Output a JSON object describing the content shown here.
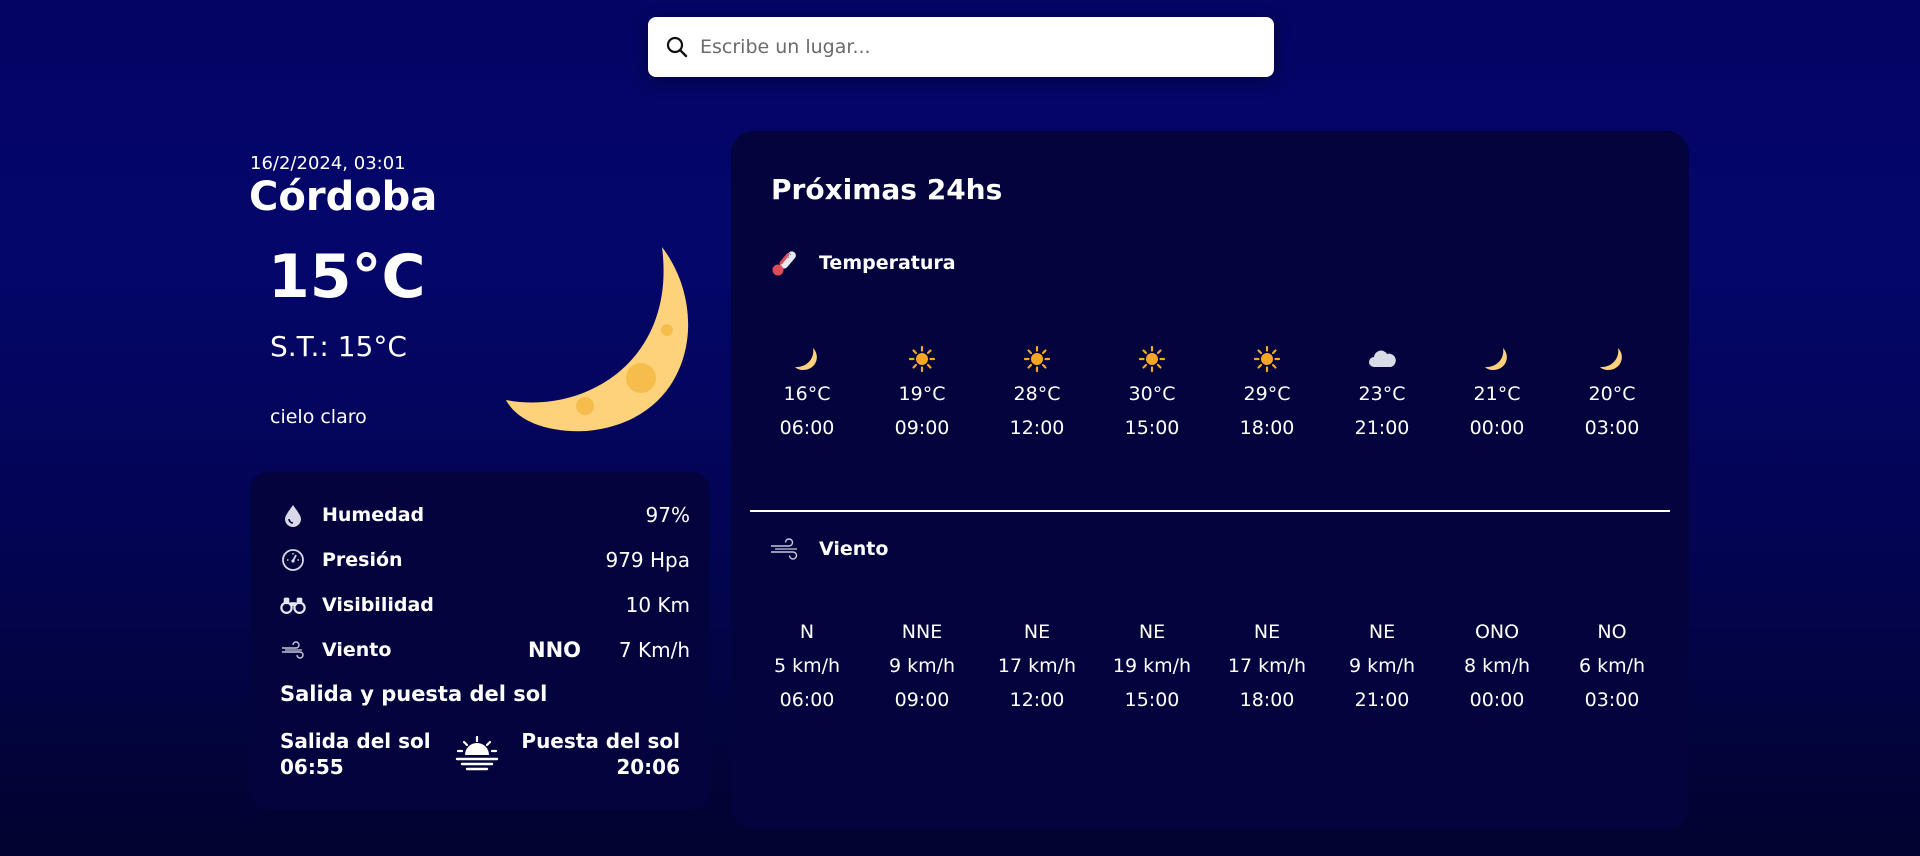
{
  "search": {
    "placeholder": "Escribe un lugar...",
    "icon": "search-icon"
  },
  "current": {
    "datetime": "16/2/2024, 03:01",
    "city": "Córdoba",
    "temp": "15°C",
    "feels_like": "S.T.: 15°C",
    "description": "cielo claro",
    "icon": "crescent-moon-icon"
  },
  "details": {
    "humidity": {
      "label": "Humedad",
      "value": "97%",
      "icon": "droplet-icon"
    },
    "pressure": {
      "label": "Presión",
      "value": "979 Hpa",
      "icon": "gauge-icon"
    },
    "visibility": {
      "label": "Visibilidad",
      "value": "10 Km",
      "icon": "binoculars-icon"
    },
    "wind": {
      "label": "Viento",
      "direction": "NNO",
      "value": "7 Km/h",
      "icon": "wind-icon"
    },
    "sun": {
      "title": "Salida y puesta del sol",
      "sunrise_label": "Salida del sol",
      "sunrise_time": "06:55",
      "sunset_label": "Puesta del sol",
      "sunset_time": "20:06",
      "icon": "sunrise-icon"
    }
  },
  "forecast": {
    "title": "Próximas 24hs",
    "temperature": {
      "label": "Temperatura",
      "icon": "thermometer-icon",
      "hours": [
        {
          "icon": "moon",
          "temp": "16°C",
          "time": "06:00"
        },
        {
          "icon": "sun",
          "temp": "19°C",
          "time": "09:00"
        },
        {
          "icon": "sun",
          "temp": "28°C",
          "time": "12:00"
        },
        {
          "icon": "sun",
          "temp": "30°C",
          "time": "15:00"
        },
        {
          "icon": "sun",
          "temp": "29°C",
          "time": "18:00"
        },
        {
          "icon": "cloud",
          "temp": "23°C",
          "time": "21:00"
        },
        {
          "icon": "moon",
          "temp": "21°C",
          "time": "00:00"
        },
        {
          "icon": "moon",
          "temp": "20°C",
          "time": "03:00"
        }
      ]
    },
    "wind": {
      "label": "Viento",
      "icon": "wind-icon",
      "hours": [
        {
          "dir": "N",
          "speed": "5 km/h",
          "time": "06:00"
        },
        {
          "dir": "NNE",
          "speed": "9 km/h",
          "time": "09:00"
        },
        {
          "dir": "NE",
          "speed": "17 km/h",
          "time": "12:00"
        },
        {
          "dir": "NE",
          "speed": "19 km/h",
          "time": "15:00"
        },
        {
          "dir": "NE",
          "speed": "17 km/h",
          "time": "18:00"
        },
        {
          "dir": "NE",
          "speed": "9 km/h",
          "time": "21:00"
        },
        {
          "dir": "ONO",
          "speed": "8 km/h",
          "time": "00:00"
        },
        {
          "dir": "NO",
          "speed": "6 km/h",
          "time": "03:00"
        }
      ]
    }
  },
  "colors": {
    "background_top": "#040464",
    "panel": "#03033d",
    "moon": "#fdd27a",
    "sun": "#f7a823",
    "cloud": "#d9dce6"
  }
}
